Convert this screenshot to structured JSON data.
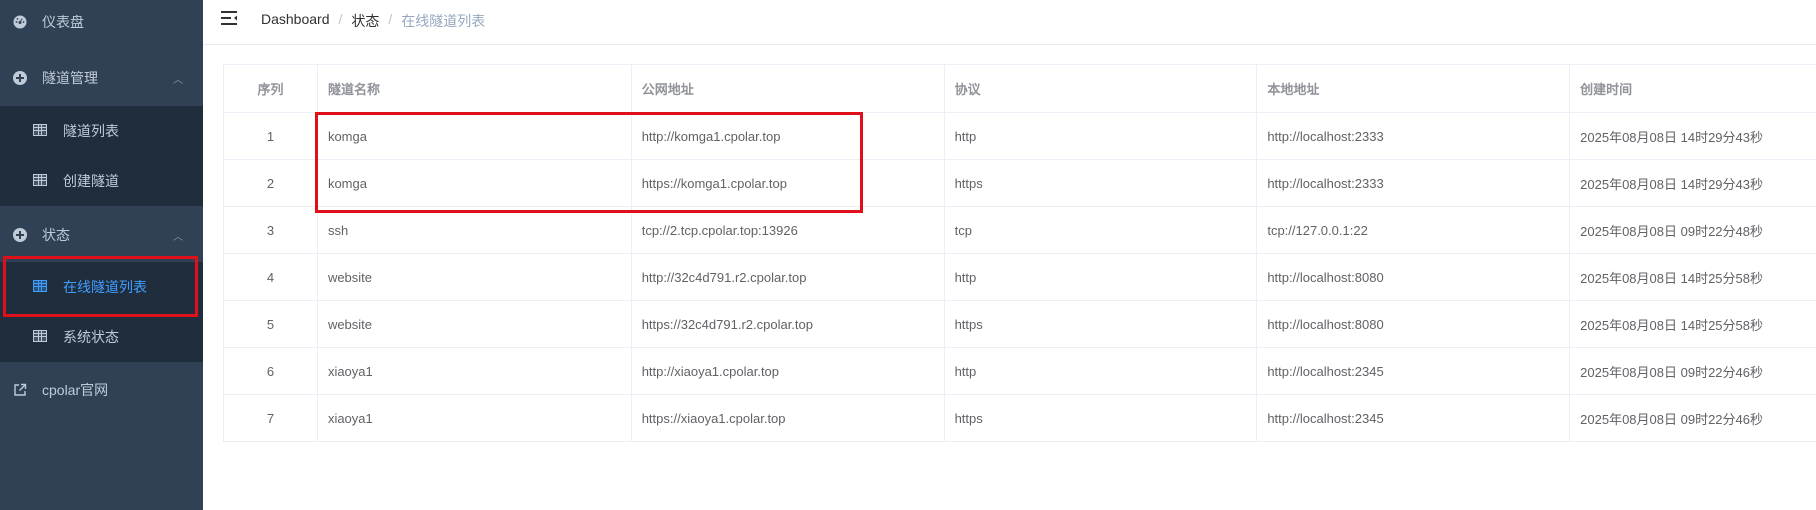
{
  "sidebar": {
    "dashboard": "仪表盘",
    "tunnel_mgmt": "隧道管理",
    "tunnel_list": "隧道列表",
    "create_tunnel": "创建隧道",
    "status": "状态",
    "online_tunnels": "在线隧道列表",
    "system_status": "系统状态",
    "cpolar_site": "cpolar官网"
  },
  "breadcrumb": {
    "home": "Dashboard",
    "section": "状态",
    "current": "在线隧道列表",
    "separator": "/"
  },
  "table": {
    "headers": [
      "序列",
      "隧道名称",
      "公网地址",
      "协议",
      "本地地址",
      "创建时间"
    ],
    "rows": [
      [
        "1",
        "komga",
        "http://komga1.cpolar.top",
        "http",
        "http://localhost:2333",
        "2025年08月08日 14时29分43秒"
      ],
      [
        "2",
        "komga",
        "https://komga1.cpolar.top",
        "https",
        "http://localhost:2333",
        "2025年08月08日 14时29分43秒"
      ],
      [
        "3",
        "ssh",
        "tcp://2.tcp.cpolar.top:13926",
        "tcp",
        "tcp://127.0.0.1:22",
        "2025年08月08日 09时22分48秒"
      ],
      [
        "4",
        "website",
        "http://32c4d791.r2.cpolar.top",
        "http",
        "http://localhost:8080",
        "2025年08月08日 14时25分58秒"
      ],
      [
        "5",
        "website",
        "https://32c4d791.r2.cpolar.top",
        "https",
        "http://localhost:8080",
        "2025年08月08日 14时25分58秒"
      ],
      [
        "6",
        "xiaoya1",
        "http://xiaoya1.cpolar.top",
        "http",
        "http://localhost:2345",
        "2025年08月08日 09时22分46秒"
      ],
      [
        "7",
        "xiaoya1",
        "https://xiaoya1.cpolar.top",
        "https",
        "http://localhost:2345",
        "2025年08月08日 09时22分46秒"
      ]
    ]
  },
  "colors": {
    "sidebar_bg": "#304156",
    "submenu_bg": "#1f2d3d",
    "active": "#409eff",
    "annotation": "#e0101a"
  }
}
